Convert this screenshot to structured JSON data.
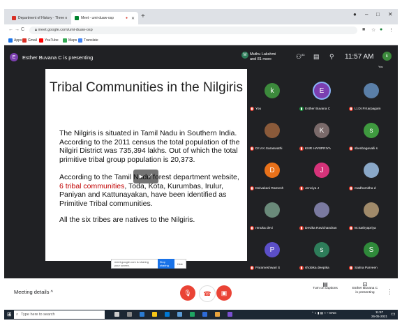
{
  "browser": {
    "tabs": [
      {
        "title": "Department of History · Three o"
      },
      {
        "title": "Meet - umi-duaw-osp"
      }
    ],
    "url": "meet.google.com/umi-duaw-osp",
    "bookmarks": [
      "Apps",
      "Gmail",
      "YouTube",
      "Maps",
      "Translate"
    ]
  },
  "meet": {
    "presenter_initial": "E",
    "presenter_text": "Esther Buvana C is presenting",
    "meeting_owner": "Muthu Lakshmi",
    "meeting_more": "and 81 more",
    "people_count": "83",
    "time": "11:57 AM",
    "you_label": "You"
  },
  "slide": {
    "title": "Tribal Communities in the Nilgiris",
    "para1": "The Nilgiris is situated in Tamil Nadu in Southern India. According to the 2011 census the total population of the Nilgiri District was 735,394 lakhs. Out of which the total primitive tribal group population is 20,373.",
    "para2_pre": "According to the Tamil Nadu forest department website, ",
    "para2_hl": "6 tribal communities",
    "para2_post": ", Toda, Kota, Kurumbas, Irulur, Paniyan and Kattunayakan, have been identified as Primitive Tribal communities.",
    "para3": "All the six tribes are natives to the Nilgiris.",
    "share_notice": "meet.google.com is sharing your screen.",
    "stop_sharing": "Stop sharing",
    "hide": "Hide"
  },
  "participants": [
    {
      "name": "You",
      "initial": "k",
      "color": "#3c8a3c",
      "photo": false
    },
    {
      "name": "Esther Buvana C",
      "initial": "E",
      "color": "#7b3fb0",
      "photo": false,
      "active": true
    },
    {
      "name": "Lt.Dr.P.Karpagam",
      "initial": "",
      "color": "#5a7fa8",
      "photo": true
    },
    {
      "name": "Dr.V.K.Saraswathi",
      "initial": "",
      "color": "#8a5a3a",
      "photo": true
    },
    {
      "name": "KNR HARIPRIYA",
      "initial": "K",
      "color": "#7a6a6a",
      "photo": false
    },
    {
      "name": "shenbagavalli s",
      "initial": "s",
      "color": "#3f9a3f",
      "photo": false
    },
    {
      "name": "Deivakani Ramesh",
      "initial": "D",
      "color": "#e8711a",
      "photo": false
    },
    {
      "name": "Jenciya J",
      "initial": "J",
      "color": "#d6337a",
      "photo": false
    },
    {
      "name": "madhumitha d",
      "initial": "",
      "color": "#8aa8c8",
      "photo": true
    },
    {
      "name": "renuka devi",
      "initial": "",
      "color": "#6a8a7a",
      "photo": true
    },
    {
      "name": "Devika Ravichandran",
      "initial": "",
      "color": "#7a7aa0",
      "photo": true
    },
    {
      "name": "M.Sathyapriya",
      "initial": "",
      "color": "#a08a6a",
      "photo": true
    },
    {
      "name": "Parameshwari S",
      "initial": "P",
      "color": "#5b4fc8",
      "photo": false
    },
    {
      "name": "shobika deepika",
      "initial": "s",
      "color": "#2e7d5a",
      "photo": false
    },
    {
      "name": "Salma Parveen",
      "initial": "S",
      "color": "#2f8a3a",
      "photo": false
    }
  ],
  "bottom": {
    "meeting_details": "Meeting details",
    "captions": "Turn on captions",
    "presenting_line1": "Esther Buvana C",
    "presenting_line2": "is presenting"
  },
  "taskbar": {
    "search_placeholder": "Type here to search",
    "lang": "ENG",
    "time": "11:57",
    "date": "26-05-2021"
  }
}
